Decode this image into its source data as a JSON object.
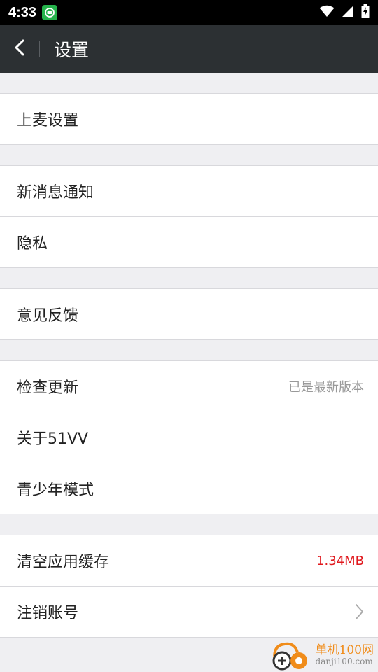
{
  "status_bar": {
    "time": "4:33",
    "icons": [
      "app-notification-icon",
      "wifi-icon",
      "signal-icon",
      "battery-charging-icon"
    ]
  },
  "header": {
    "title": "设置",
    "back_icon": "chevron-left-icon"
  },
  "groups": [
    {
      "items": [
        {
          "label": "上麦设置"
        }
      ]
    },
    {
      "items": [
        {
          "label": "新消息通知"
        },
        {
          "label": "隐私"
        }
      ]
    },
    {
      "items": [
        {
          "label": "意见反馈"
        }
      ]
    },
    {
      "items": [
        {
          "label": "检查更新",
          "value": "已是最新版本"
        },
        {
          "label": "关于51VV"
        },
        {
          "label": "青少年模式"
        }
      ]
    },
    {
      "items": [
        {
          "label": "清空应用缓存",
          "value": "1.34MB",
          "value_color": "#e0191e"
        },
        {
          "label": "注销账号",
          "icon": "chevron-right-icon"
        }
      ]
    }
  ],
  "watermark": {
    "title": "单机100网",
    "url": "danji100.com"
  }
}
